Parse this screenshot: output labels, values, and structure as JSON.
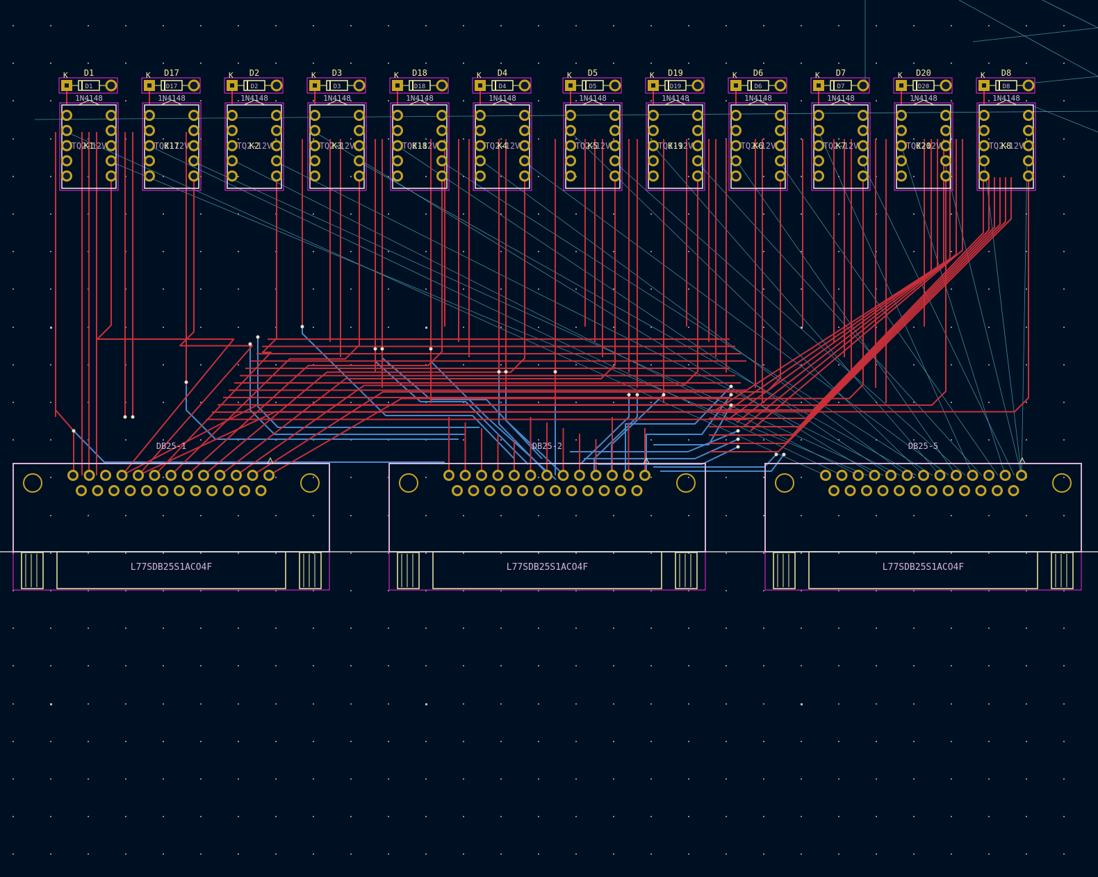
{
  "colors": {
    "background": "#001023",
    "grid": "#8a8f9c",
    "front_copper": "#c8303a",
    "back_copper": "#4a88c8",
    "ratsnest": "#4fa0b0",
    "courtyard": "#ff26e2",
    "silkscreen": "#f2eda1",
    "fab": "#d6b4d8",
    "pad": "#c8a520",
    "hole": "#0a1a30"
  },
  "modules": [
    {
      "diode": "D1",
      "relay": "K1",
      "pad_k": "K"
    },
    {
      "diode": "D17",
      "relay": "K17",
      "pad_k": "K"
    },
    {
      "diode": "D2",
      "relay": "K2",
      "pad_k": "K"
    },
    {
      "diode": "D3",
      "relay": "K3",
      "pad_k": "K"
    },
    {
      "diode": "D18",
      "relay": "K18",
      "pad_k": "K"
    },
    {
      "diode": "D4",
      "relay": "K4",
      "pad_k": "K"
    },
    {
      "diode": "D5",
      "relay": "K5",
      "pad_k": "K"
    },
    {
      "diode": "D19",
      "relay": "K19",
      "pad_k": "K"
    },
    {
      "diode": "D6",
      "relay": "K6",
      "pad_k": "K"
    },
    {
      "diode": "D7",
      "relay": "K7",
      "pad_k": "K"
    },
    {
      "diode": "D20",
      "relay": "K20",
      "pad_k": "K"
    },
    {
      "diode": "D8",
      "relay": "K8",
      "pad_k": "K"
    }
  ],
  "diode_value": "1N4148",
  "relay_value": "TQ2-12V",
  "connectors": [
    {
      "ref": "DB25-1",
      "value": "L77SDB25S1ACO4F"
    },
    {
      "ref": "DB25-2",
      "value": "L77SDB25S1ACO4F"
    },
    {
      "ref": "DB25-5",
      "value": "L77SDB25S1ACO4F"
    }
  ]
}
